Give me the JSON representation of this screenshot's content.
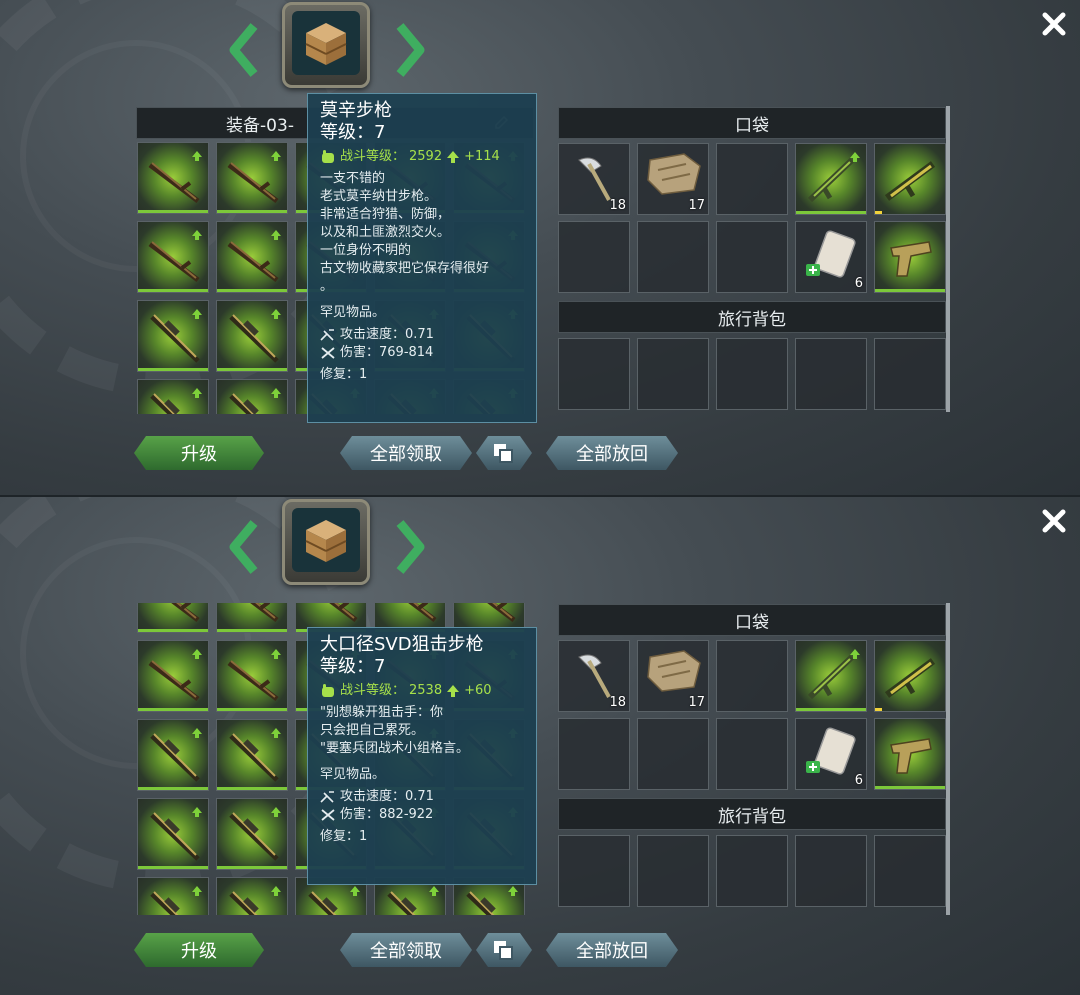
{
  "panels": [
    {
      "loadout_label": "装备-03-",
      "pocket_label": "口袋",
      "backpack_label": "旅行背包",
      "tooltip": {
        "name": "莫辛步枪",
        "level": "等级：7",
        "power_label": "战斗等级：",
        "power_value": "2592",
        "power_delta": "+114",
        "description": "一支不错的\n老式莫辛纳甘步枪。\n非常适合狩猎、防御，\n以及和土匪激烈交火。\n一位身份不明的\n古文物收藏家把它保存得很好\n。",
        "rarity": "罕见物品。",
        "attack_speed": "攻击速度：0.71",
        "damage": "伤害：769-814",
        "repair": "修复：1"
      }
    },
    {
      "loadout_label": "",
      "pocket_label": "口袋",
      "backpack_label": "旅行背包",
      "tooltip": {
        "name": "大口径SVD狙击步枪",
        "level": "等级：7",
        "power_label": "战斗等级：",
        "power_value": "2538",
        "power_delta": "+60",
        "description": "\"别想躲开狙击手：你\n只会把自己累死。\n\"要塞兵团战术小组格言。",
        "rarity": "罕见物品。",
        "attack_speed": "攻击速度：0.71",
        "damage": "伤害：882-922",
        "repair": "修复：1"
      }
    }
  ],
  "pocket_items": [
    {
      "icon": "hatchet-icon",
      "count": "18"
    },
    {
      "icon": "cloth-icon",
      "count": "17"
    },
    {
      "icon": "",
      "count": ""
    },
    {
      "icon": "assault-rifle-icon",
      "count": ""
    },
    {
      "icon": "gold-rifle-icon",
      "count": ""
    },
    {
      "icon": "",
      "count": ""
    },
    {
      "icon": "",
      "count": ""
    },
    {
      "icon": "",
      "count": ""
    },
    {
      "icon": "bandage-icon",
      "count": "6"
    },
    {
      "icon": "pistol-icon",
      "count": ""
    }
  ],
  "buttons": {
    "upgrade": "升级",
    "take_all": "全部领取",
    "return_all": "全部放回"
  },
  "colors": {
    "accent_green": "#7cc83a",
    "tooltip_bg": "#1c3f50",
    "power_green": "#a6e04a"
  }
}
